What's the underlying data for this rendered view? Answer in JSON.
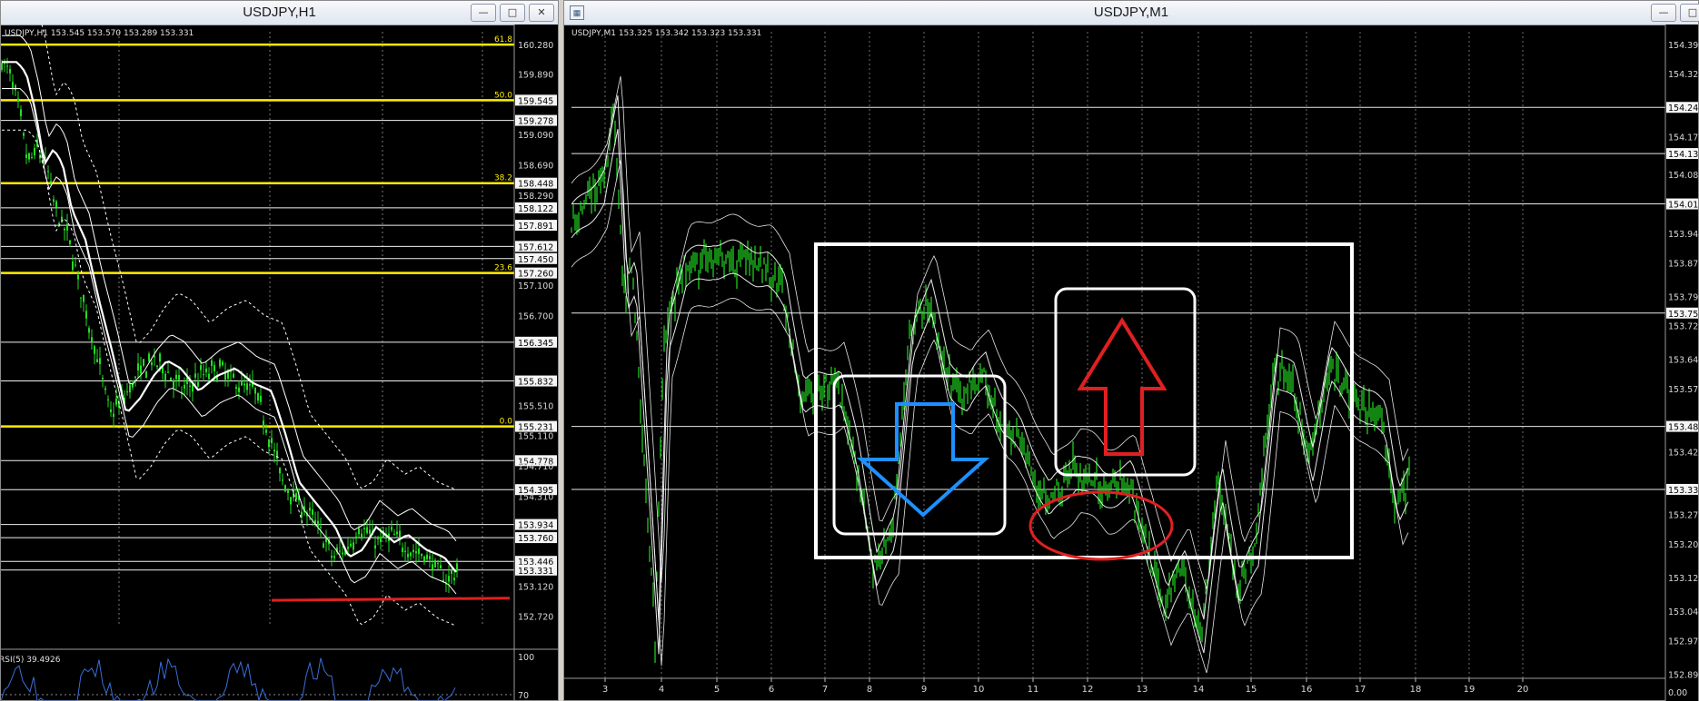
{
  "left_window": {
    "title": "USDJPY,H1",
    "info": "USDJPY,H1  153.545 153.570 153.289 153.331",
    "fib_levels": [
      {
        "label": "61.8",
        "price": "160.280"
      },
      {
        "label": "50.0",
        "price": "159.545"
      },
      {
        "label": "38.2",
        "price": "158.448"
      },
      {
        "label": "23.6",
        "price": "157.260"
      },
      {
        "label": "0.0",
        "price": "155.231"
      }
    ],
    "price_scale": [
      "160.280",
      "159.890",
      "159.545",
      "159.278",
      "159.090",
      "158.690",
      "158.448",
      "158.290",
      "158.122",
      "157.891",
      "157.612",
      "157.450",
      "157.260",
      "157.100",
      "156.700",
      "156.345",
      "155.832",
      "155.510",
      "155.231",
      "155.110",
      "154.778",
      "154.710",
      "154.395",
      "154.310",
      "153.934",
      "153.760",
      "153.446",
      "153.331",
      "153.120",
      "152.720"
    ],
    "highlighted_prices": [
      "159.545",
      "159.278",
      "158.448",
      "158.122",
      "157.891",
      "157.612",
      "157.450",
      "157.260",
      "156.345",
      "155.832",
      "155.231",
      "154.778",
      "154.395",
      "153.934",
      "153.760",
      "153.446",
      "153.331"
    ],
    "rsi_label": "RSI(5) 39.4926",
    "rsi_scale": [
      "100",
      "70"
    ]
  },
  "right_window": {
    "title": "USDJPY,M1",
    "info": "USDJPY,M1  153.325 153.342 153.323 153.331",
    "price_scale": [
      "154.39",
      "154.32",
      "154.24",
      "154.17",
      "154.13",
      "154.08",
      "154.01",
      "153.94",
      "153.87",
      "153.79",
      "153.75",
      "153.72",
      "153.64",
      "153.57",
      "153.48",
      "153.42",
      "153.33",
      "153.27",
      "153.20",
      "153.12",
      "153.04",
      "152.97",
      "152.89",
      "0.00"
    ],
    "highlighted_prices": [
      "154.24",
      "154.13",
      "154.01",
      "153.75",
      "153.48",
      "153.33"
    ],
    "time_axis": [
      "3",
      "4",
      "5",
      "6",
      "7",
      "8",
      "9",
      "10",
      "11",
      "12",
      "13",
      "14",
      "15",
      "16",
      "17",
      "18",
      "19",
      "20"
    ]
  },
  "colors": {
    "candles": "#22dd22",
    "fib": "#ffee00",
    "bands": "#ffffff",
    "arrow_down": "#1e90ff",
    "arrow_up": "#e02020",
    "support_line": "#e02020",
    "rsi": "#3a6ed8"
  },
  "icons": [
    "minimize-icon",
    "maximize-icon",
    "close-icon",
    "window-icon"
  ]
}
